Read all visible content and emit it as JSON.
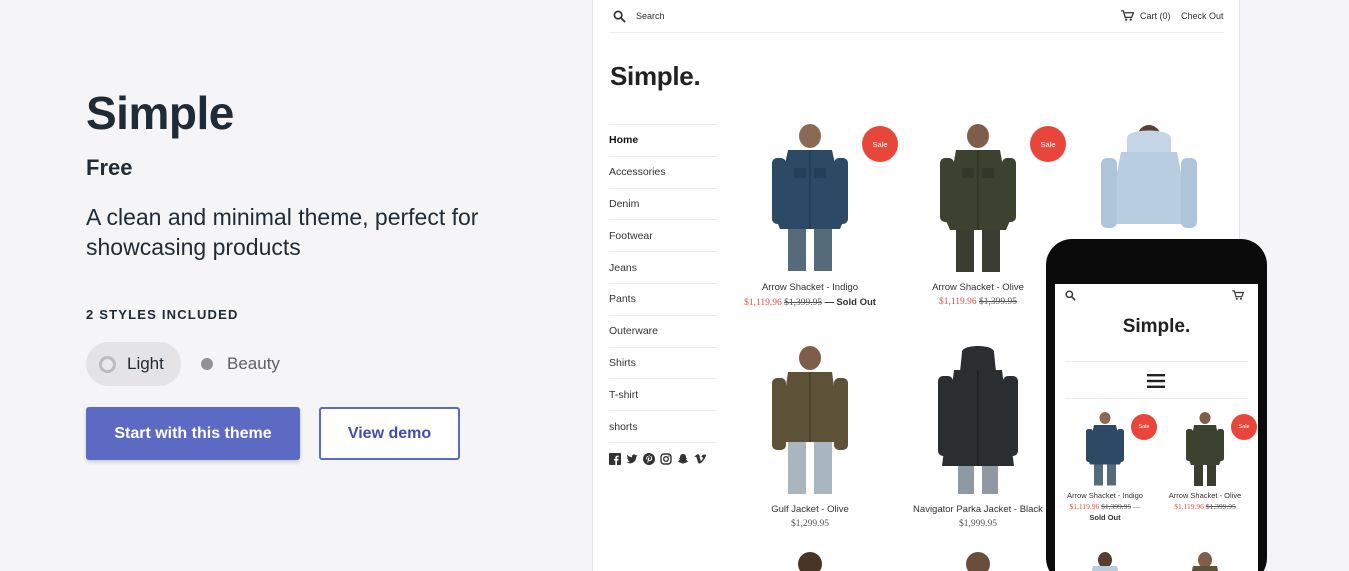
{
  "theme": {
    "title": "Simple",
    "price": "Free",
    "description": "A clean and minimal theme, perfect for showcasing products",
    "styles_heading": "2 STYLES INCLUDED",
    "styles": [
      "Light",
      "Beauty"
    ],
    "primary_button": "Start with this theme",
    "secondary_button": "View demo"
  },
  "preview": {
    "search_label": "Search",
    "cart_label": "Cart (0)",
    "checkout_label": "Check Out",
    "logo": "Simple.",
    "nav": [
      "Home",
      "Accessories",
      "Denim",
      "Footwear",
      "Jeans",
      "Pants",
      "Outerware",
      "Shirts",
      "T-shirt",
      "shorts"
    ],
    "social_icons": [
      "facebook-icon",
      "twitter-icon",
      "pinterest-icon",
      "instagram-icon",
      "snapchat-icon",
      "vimeo-icon"
    ],
    "products": [
      {
        "name": "Arrow Shacket - Indigo",
        "sale_price": "$1,119.96",
        "original_price": "$1,399.95",
        "separator": "—",
        "sold_out": "Sold Out",
        "badge": "Sale",
        "color": "#2c4a66"
      },
      {
        "name": "Arrow Shacket - Olive",
        "sale_price": "$1,119.96",
        "original_price": "$1,399.95",
        "badge": "Sale",
        "color": "#3d4230"
      },
      {
        "name": "",
        "color": "#b9cde0"
      },
      {
        "name": "Gulf Jacket - Olive",
        "price": "$1,299.95",
        "color": "#5d5137"
      },
      {
        "name": "Navigator Parka Jacket - Black",
        "price": "$1,999.95",
        "color": "#2a2e31"
      }
    ]
  },
  "phone": {
    "logo": "Simple.",
    "products": [
      {
        "name": "Arrow Shacket - Indigo",
        "sale_price": "$1,119.96",
        "original_price": "$1,399.95",
        "separator": "—",
        "sold_out": "Sold Out",
        "badge": "Sale"
      },
      {
        "name": "Arrow Shacket - Olive",
        "sale_price": "$1,119.96",
        "original_price": "$1,399.95",
        "badge": "Sale"
      }
    ]
  },
  "colors": {
    "accent": "#5c6ac4",
    "sale_badge": "#e8463b",
    "sale_price": "#e44d3a"
  }
}
